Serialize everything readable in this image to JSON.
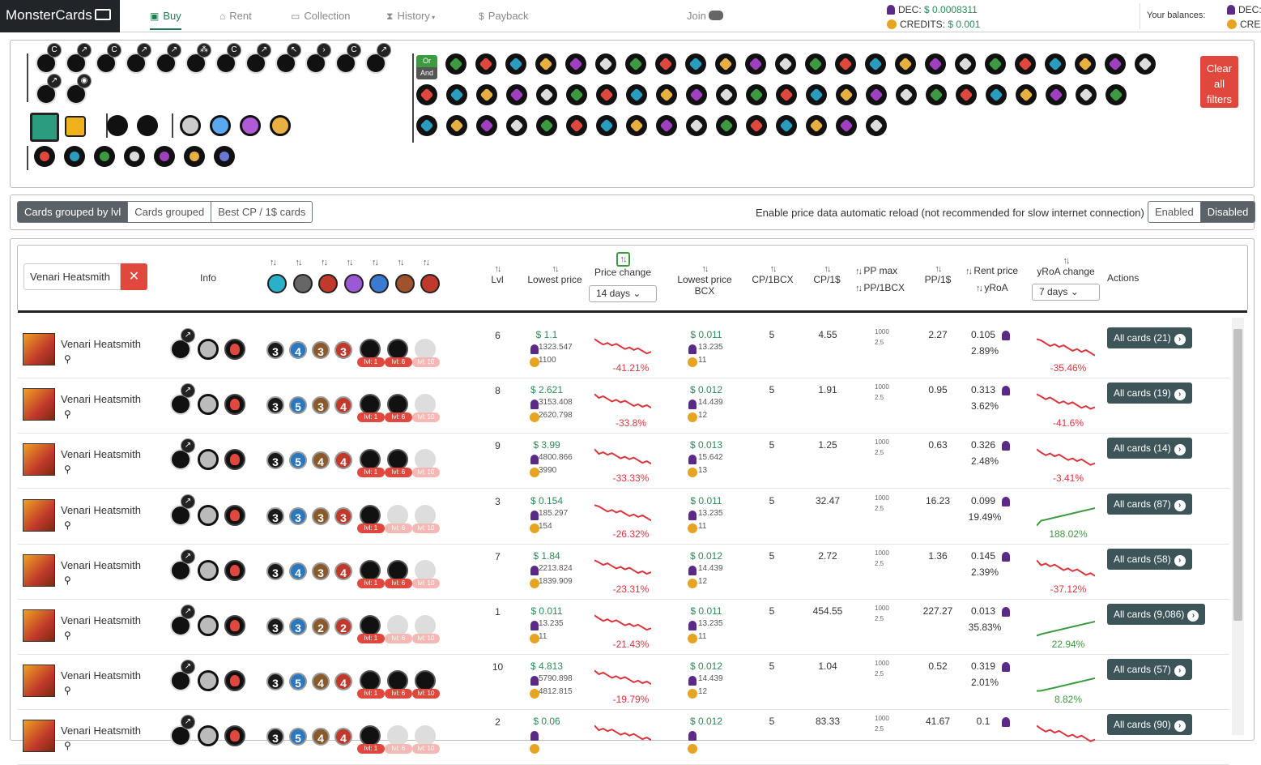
{
  "brand": "MonsterCards",
  "nav": {
    "buy": "Buy",
    "rent": "Rent",
    "collection": "Collection",
    "history": "History",
    "payback": "Payback",
    "join": "Join"
  },
  "prices": {
    "dec_label": "DEC:",
    "dec_value": "$ 0.0008311",
    "credits_label": "CREDITS:",
    "credits_value": "$ 0.001"
  },
  "balances": {
    "label": "Your balances:",
    "dec": "DEC:",
    "credits": "CRED"
  },
  "filters": {
    "or": "Or",
    "and": "And",
    "clear": "Clear all filters"
  },
  "group_buttons": [
    "Cards grouped by lvl",
    "Cards grouped",
    "Best CP / 1$ cards"
  ],
  "reload": {
    "text": "Enable price data automatic reload (not recommended for slow internet connection)",
    "enabled": "Enabled",
    "disabled": "Disabled"
  },
  "search": {
    "value": "Venari Heatsmith"
  },
  "headers": {
    "info": "Info",
    "lvl": "Lvl",
    "lowest_price": "Lowest price",
    "price_change": "Price change",
    "price_period": "14 days",
    "lowest_bcx": "Lowest price BCX",
    "cp_bcx": "CP/1BCX",
    "cp_usd": "CP/1$",
    "pp_max": "PP max",
    "pp_bcx": "PP/1BCX",
    "pp_usd": "PP/1$",
    "rent_price": "Rent price",
    "yroa": "yRoA",
    "yroa_change": "yRoA change",
    "yroa_period": "7 days",
    "actions": "Actions"
  },
  "colors": {
    "red": "#e0483e",
    "green": "#3c9a40",
    "dark": "#3d5558"
  },
  "rows": [
    {
      "name": "Venari Heatsmith",
      "stats": [
        "3",
        "4",
        "3",
        "3"
      ],
      "lvl": "6",
      "price": "$ 1.1",
      "dec": "1323.547",
      "credits": "1100",
      "change": "-41.21%",
      "bcx": "$ 0.011",
      "bcx_dec": "13.235",
      "bcx_cr": "11",
      "cp_bcx": "5",
      "cp_usd": "4.55",
      "pp1": "1000",
      "pp2": "2.5",
      "pp_usd": "2.27",
      "rent": "0.105",
      "yroa": "2.89%",
      "ychange": "-35.46%",
      "actions": "All cards (21)",
      "tags": [
        true,
        true,
        false
      ],
      "trend": "neg",
      "ytrend": "neg"
    },
    {
      "name": "Venari Heatsmith",
      "stats": [
        "3",
        "5",
        "3",
        "4"
      ],
      "lvl": "8",
      "price": "$ 2.621",
      "dec": "3153.408",
      "credits": "2620.798",
      "change": "-33.8%",
      "bcx": "$ 0.012",
      "bcx_dec": "14.439",
      "bcx_cr": "12",
      "cp_bcx": "5",
      "cp_usd": "1.91",
      "pp1": "1000",
      "pp2": "2.5",
      "pp_usd": "0.95",
      "rent": "0.313",
      "yroa": "3.62%",
      "ychange": "-41.6%",
      "actions": "All cards (19)",
      "tags": [
        true,
        true,
        false
      ],
      "trend": "neg",
      "ytrend": "neg"
    },
    {
      "name": "Venari Heatsmith",
      "stats": [
        "3",
        "5",
        "4",
        "4"
      ],
      "lvl": "9",
      "price": "$ 3.99",
      "dec": "4800.866",
      "credits": "3990",
      "change": "-33.33%",
      "bcx": "$ 0.013",
      "bcx_dec": "15.642",
      "bcx_cr": "13",
      "cp_bcx": "5",
      "cp_usd": "1.25",
      "pp1": "1000",
      "pp2": "2.5",
      "pp_usd": "0.63",
      "rent": "0.326",
      "yroa": "2.48%",
      "ychange": "-3.41%",
      "actions": "All cards (14)",
      "tags": [
        true,
        true,
        false
      ],
      "trend": "neg",
      "ytrend": "neg"
    },
    {
      "name": "Venari Heatsmith",
      "stats": [
        "3",
        "3",
        "3",
        "3"
      ],
      "lvl": "3",
      "price": "$ 0.154",
      "dec": "185.297",
      "credits": "154",
      "change": "-26.32%",
      "bcx": "$ 0.011",
      "bcx_dec": "13.235",
      "bcx_cr": "11",
      "cp_bcx": "5",
      "cp_usd": "32.47",
      "pp1": "1000",
      "pp2": "2.5",
      "pp_usd": "16.23",
      "rent": "0.099",
      "yroa": "19.49%",
      "ychange": "188.02%",
      "actions": "All cards (87)",
      "tags": [
        true,
        false,
        false
      ],
      "trend": "neg",
      "ytrend": "pos"
    },
    {
      "name": "Venari Heatsmith",
      "stats": [
        "3",
        "4",
        "3",
        "4"
      ],
      "lvl": "7",
      "price": "$ 1.84",
      "dec": "2213.824",
      "credits": "1839.909",
      "change": "-23.31%",
      "bcx": "$ 0.012",
      "bcx_dec": "14.439",
      "bcx_cr": "12",
      "cp_bcx": "5",
      "cp_usd": "2.72",
      "pp1": "1000",
      "pp2": "2.5",
      "pp_usd": "1.36",
      "rent": "0.145",
      "yroa": "2.39%",
      "ychange": "-37.12%",
      "actions": "All cards (58)",
      "tags": [
        true,
        true,
        false
      ],
      "trend": "neg",
      "ytrend": "neg"
    },
    {
      "name": "Venari Heatsmith",
      "stats": [
        "3",
        "3",
        "2",
        "2"
      ],
      "lvl": "1",
      "price": "$ 0.011",
      "dec": "13.235",
      "credits": "11",
      "change": "-21.43%",
      "bcx": "$ 0.011",
      "bcx_dec": "13.235",
      "bcx_cr": "11",
      "cp_bcx": "5",
      "cp_usd": "454.55",
      "pp1": "1000",
      "pp2": "2.5",
      "pp_usd": "227.27",
      "rent": "0.013",
      "yroa": "35.83%",
      "ychange": "22.94%",
      "actions": "All cards (9,086)",
      "tags": [
        true,
        false,
        false
      ],
      "trend": "neg",
      "ytrend": "pos"
    },
    {
      "name": "Venari Heatsmith",
      "stats": [
        "3",
        "5",
        "4",
        "4"
      ],
      "lvl": "10",
      "price": "$ 4.813",
      "dec": "5790.898",
      "credits": "4812.815",
      "change": "-19.79%",
      "bcx": "$ 0.012",
      "bcx_dec": "14.439",
      "bcx_cr": "12",
      "cp_bcx": "5",
      "cp_usd": "1.04",
      "pp1": "1000",
      "pp2": "2.5",
      "pp_usd": "0.52",
      "rent": "0.319",
      "yroa": "2.01%",
      "ychange": "8.82%",
      "actions": "All cards (57)",
      "tags": [
        true,
        true,
        true
      ],
      "trend": "neg",
      "ytrend": "pos"
    },
    {
      "name": "Venari Heatsmith",
      "stats": [
        "3",
        "5",
        "4",
        "4"
      ],
      "lvl": "2",
      "price": "$ 0.06",
      "dec": "",
      "credits": "",
      "change": "",
      "bcx": "$ 0.012",
      "bcx_dec": "",
      "bcx_cr": "",
      "cp_bcx": "5",
      "cp_usd": "83.33",
      "pp1": "1000",
      "pp2": "2.5",
      "pp_usd": "41.67",
      "rent": "0.1",
      "yroa": "",
      "ychange": "",
      "actions": "All cards (90)",
      "tags": [
        true,
        false,
        false
      ],
      "trend": "neg",
      "ytrend": "neg"
    }
  ],
  "tag_labels": [
    "lvl: 1",
    "lvl: 6",
    "lvl: 10"
  ]
}
